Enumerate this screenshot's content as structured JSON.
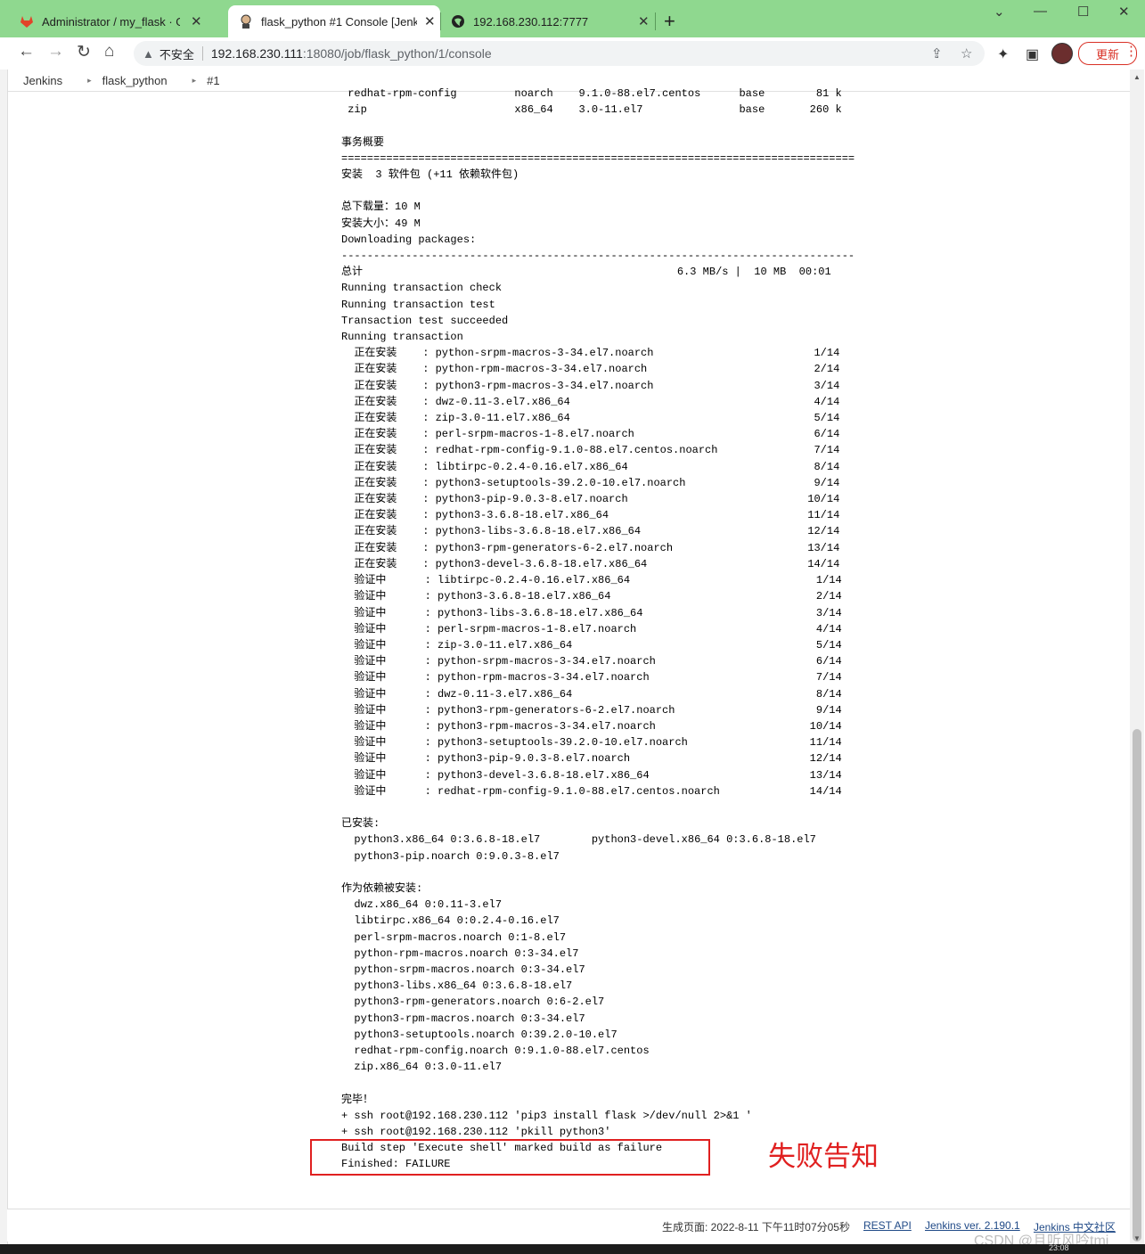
{
  "browser": {
    "tabs": [
      {
        "label": "Administrator / my_flask · GitL"
      },
      {
        "label": "flask_python #1 Console [Jenk"
      },
      {
        "label": "192.168.230.112:7777"
      }
    ],
    "new_tab": "+",
    "close": "✕",
    "security_label": "不安全",
    "url_host": "192.168.230.111",
    "url_path": ":18080/job/flask_python/1/console",
    "update_label": "更新"
  },
  "breadcrumb": {
    "items": [
      "Jenkins",
      "flask_python",
      "#1"
    ]
  },
  "console": {
    "lines": [
      " redhat-rpm-config         noarch    9.1.0-88.el7.centos      base        81 k",
      " zip                       x86_64    3.0-11.el7               base       260 k",
      "",
      "事务概要",
      "================================================================================",
      "安装  3 软件包 (+11 依赖软件包)",
      "",
      "总下载量：10 M",
      "安装大小：49 M",
      "Downloading packages:",
      "--------------------------------------------------------------------------------",
      "总计                                                 6.3 MB/s |  10 MB  00:01",
      "Running transaction check",
      "Running transaction test",
      "Transaction test succeeded",
      "Running transaction",
      "  正在安装    : python-srpm-macros-3-34.el7.noarch                         1/14",
      "  正在安装    : python-rpm-macros-3-34.el7.noarch                          2/14",
      "  正在安装    : python3-rpm-macros-3-34.el7.noarch                         3/14",
      "  正在安装    : dwz-0.11-3.el7.x86_64                                      4/14",
      "  正在安装    : zip-3.0-11.el7.x86_64                                      5/14",
      "  正在安装    : perl-srpm-macros-1-8.el7.noarch                            6/14",
      "  正在安装    : redhat-rpm-config-9.1.0-88.el7.centos.noarch               7/14",
      "  正在安装    : libtirpc-0.2.4-0.16.el7.x86_64                             8/14",
      "  正在安装    : python3-setuptools-39.2.0-10.el7.noarch                    9/14",
      "  正在安装    : python3-pip-9.0.3-8.el7.noarch                            10/14",
      "  正在安装    : python3-3.6.8-18.el7.x86_64                               11/14",
      "  正在安装    : python3-libs-3.6.8-18.el7.x86_64                          12/14",
      "  正在安装    : python3-rpm-generators-6-2.el7.noarch                     13/14",
      "  正在安装    : python3-devel-3.6.8-18.el7.x86_64                         14/14",
      "  验证中      : libtirpc-0.2.4-0.16.el7.x86_64                             1/14",
      "  验证中      : python3-3.6.8-18.el7.x86_64                                2/14",
      "  验证中      : python3-libs-3.6.8-18.el7.x86_64                           3/14",
      "  验证中      : perl-srpm-macros-1-8.el7.noarch                            4/14",
      "  验证中      : zip-3.0-11.el7.x86_64                                      5/14",
      "  验证中      : python-srpm-macros-3-34.el7.noarch                         6/14",
      "  验证中      : python-rpm-macros-3-34.el7.noarch                          7/14",
      "  验证中      : dwz-0.11-3.el7.x86_64                                      8/14",
      "  验证中      : python3-rpm-generators-6-2.el7.noarch                      9/14",
      "  验证中      : python3-rpm-macros-3-34.el7.noarch                        10/14",
      "  验证中      : python3-setuptools-39.2.0-10.el7.noarch                   11/14",
      "  验证中      : python3-pip-9.0.3-8.el7.noarch                            12/14",
      "  验证中      : python3-devel-3.6.8-18.el7.x86_64                         13/14",
      "  验证中      : redhat-rpm-config-9.1.0-88.el7.centos.noarch              14/14",
      "",
      "已安装:",
      "  python3.x86_64 0:3.6.8-18.el7        python3-devel.x86_64 0:3.6.8-18.el7",
      "  python3-pip.noarch 0:9.0.3-8.el7",
      "",
      "作为依赖被安装:",
      "  dwz.x86_64 0:0.11-3.el7",
      "  libtirpc.x86_64 0:0.2.4-0.16.el7",
      "  perl-srpm-macros.noarch 0:1-8.el7",
      "  python-rpm-macros.noarch 0:3-34.el7",
      "  python-srpm-macros.noarch 0:3-34.el7",
      "  python3-libs.x86_64 0:3.6.8-18.el7",
      "  python3-rpm-generators.noarch 0:6-2.el7",
      "  python3-rpm-macros.noarch 0:3-34.el7",
      "  python3-setuptools.noarch 0:39.2.0-10.el7",
      "  redhat-rpm-config.noarch 0:9.1.0-88.el7.centos",
      "  zip.x86_64 0:3.0-11.el7",
      "",
      "完毕！",
      "+ ssh root@192.168.230.112 'pip3 install flask >/dev/null 2>&1 '",
      "+ ssh root@192.168.230.112 'pkill python3'",
      "Build step 'Execute shell' marked build as failure",
      "Finished: FAILURE"
    ]
  },
  "annotation": "失败告知",
  "footer": {
    "generated": "生成页面: 2022-8-11 下午11时07分05秒",
    "rest_api": "REST API",
    "version": "Jenkins ver. 2.190.1",
    "community": "Jenkins 中文社区"
  },
  "watermark": "CSDN @且听风吟tmj",
  "taskbar_clock": "23:08"
}
